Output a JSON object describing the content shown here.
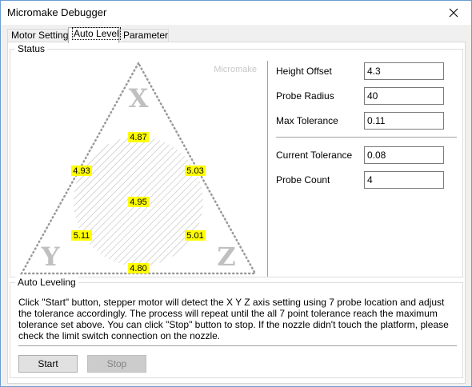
{
  "window": {
    "title": "Micromake Debugger"
  },
  "tabs": [
    {
      "label": "Motor Setting"
    },
    {
      "label": "Auto Level"
    },
    {
      "label": "Parameter"
    }
  ],
  "status": {
    "legend": "Status",
    "brand": "Micromake",
    "axes": {
      "x": "X",
      "y": "Y",
      "z": "Z"
    },
    "probes": {
      "top": "4.87",
      "upper_left": "4.93",
      "upper_right": "5.03",
      "center": "4.95",
      "lower_left": "5.11",
      "lower_right": "5.01",
      "bottom": "4.80"
    },
    "colors": {
      "probe_highlight": "#ffff00",
      "axis_gray": "#c0c0c0",
      "dot_gray": "#9a9a9a"
    },
    "fields": {
      "height_offset": {
        "label": "Height Offset",
        "value": "4.3"
      },
      "probe_radius": {
        "label": "Probe Radius",
        "value": "40"
      },
      "max_tolerance": {
        "label": "Max Tolerance",
        "value": "0.11"
      },
      "current_tolerance": {
        "label": "Current Tolerance",
        "value": "0.08"
      },
      "probe_count": {
        "label": "Probe Count",
        "value": "4"
      }
    }
  },
  "auto_leveling": {
    "legend": "Auto Leveling",
    "description": "Click \"Start\" button, stepper motor will detect the X Y Z axis setting using 7 probe location and adjust the tolerance accordingly. The process will repeat until the all 7 point tolerance reach the maximum tolerance set above. You can click \"Stop\" button to stop. If the nozzle didn't touch the platform, please check the limit switch connection on the nozzle.",
    "start_label": "Start",
    "stop_label": "Stop"
  }
}
